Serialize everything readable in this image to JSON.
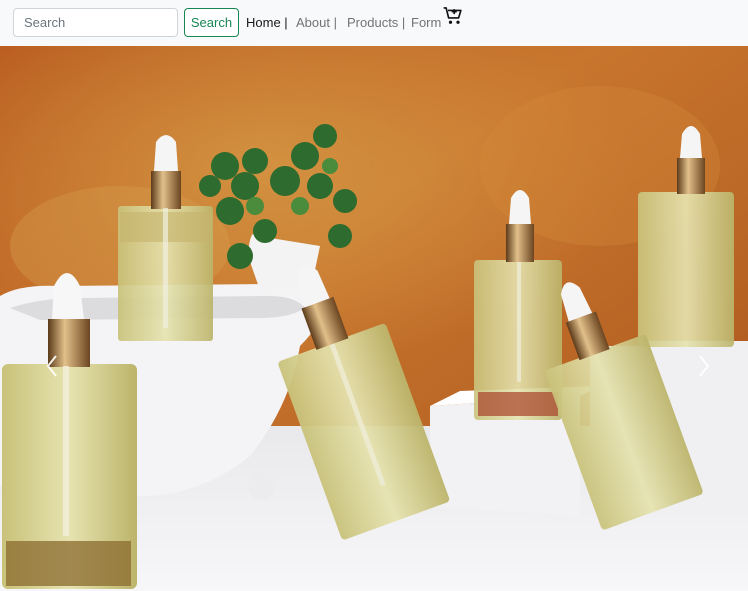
{
  "navbar": {
    "search_placeholder": "Search",
    "search_button": "Search",
    "links": [
      "Home |",
      "About |",
      "Products |",
      "Form"
    ],
    "active_link": "Home |",
    "cart_icon": "cart-plus-icon",
    "accent_color": "#198754"
  },
  "carousel": {
    "prev_icon": "chevron-left-icon",
    "next_icon": "chevron-right-icon",
    "slide_subject": "oil dropper bottles"
  }
}
